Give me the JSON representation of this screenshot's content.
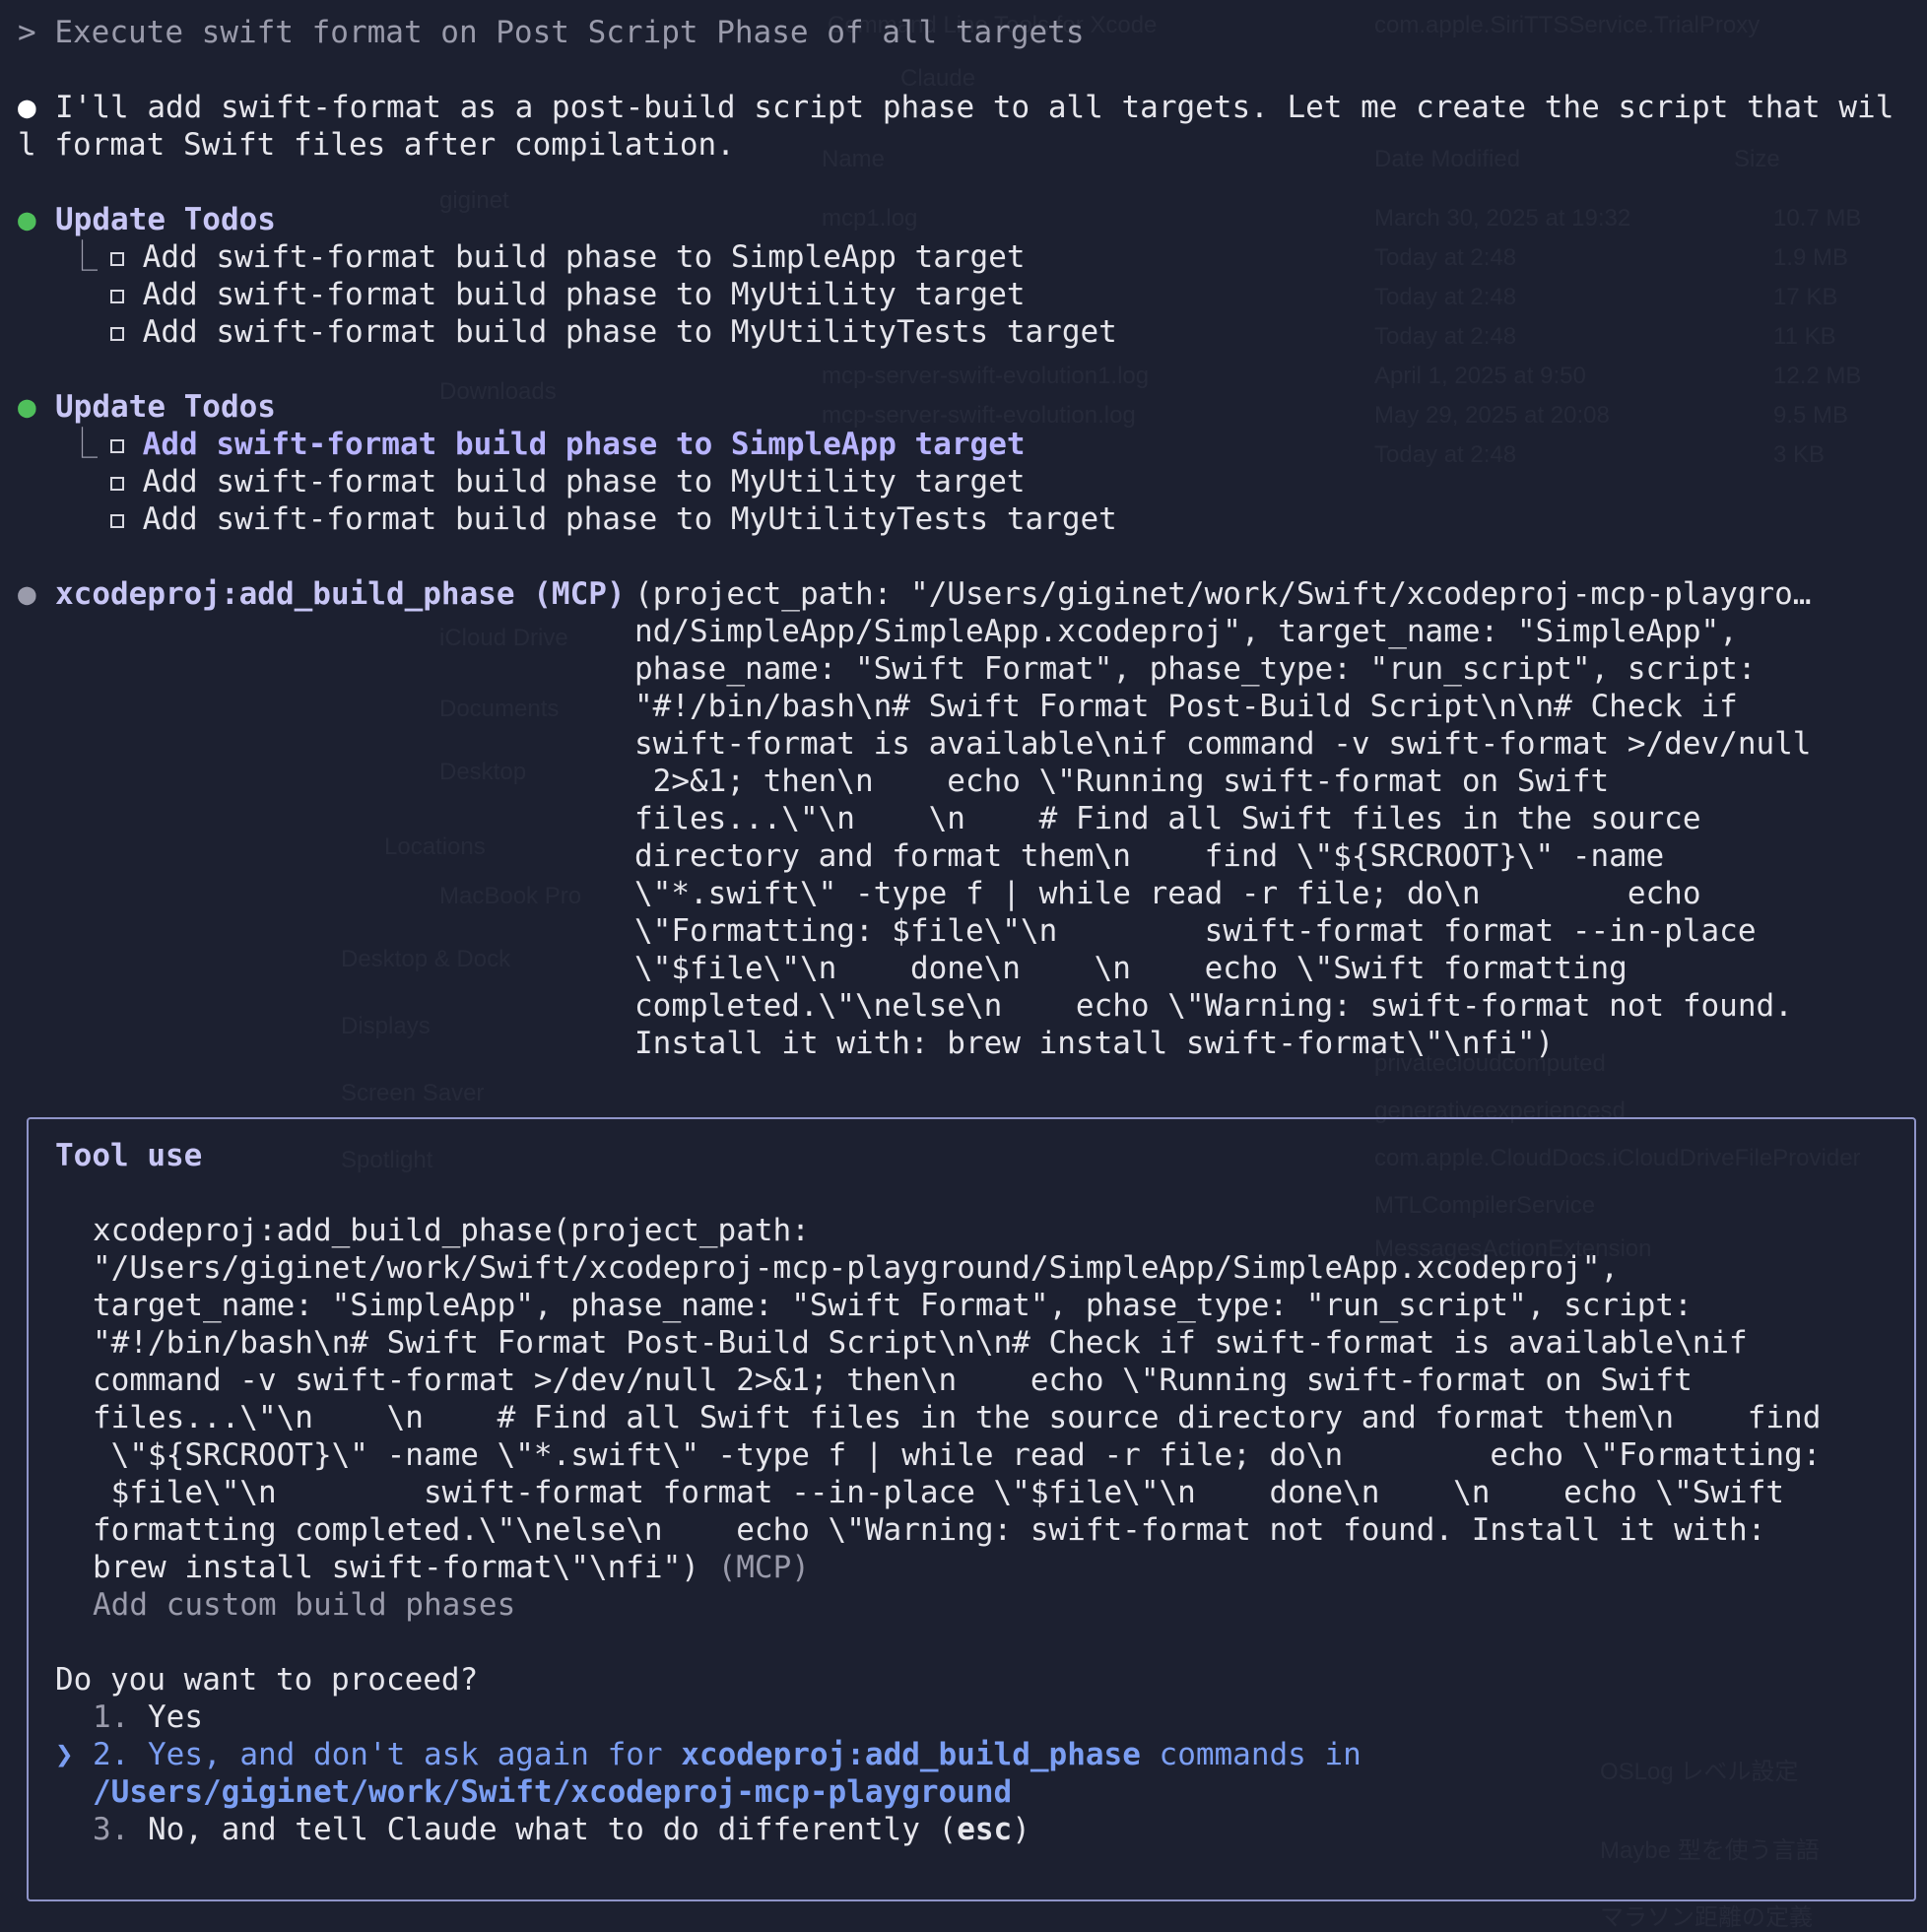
{
  "prompt": {
    "marker": ">",
    "text": "Execute swift format on Post Script Phase of all targets"
  },
  "assistant_message": {
    "line1": "I'll add swift-format as a post-build script phase to all targets. Let me create the script that wil",
    "line2": "l format Swift files after compilation."
  },
  "todo_blocks": [
    {
      "title": "Update Todos",
      "items": [
        "Add swift-format build phase to SimpleApp target",
        "Add swift-format build phase to MyUtility target",
        "Add swift-format build phase to MyUtilityTests target"
      ]
    },
    {
      "title": "Update Todos",
      "items": [
        "Add swift-format build phase to SimpleApp target",
        "Add swift-format build phase to MyUtility target",
        "Add swift-format build phase to MyUtilityTests target"
      ]
    }
  ],
  "tool_call": {
    "name": "xcodeproj:add_build_phase (MCP)",
    "lines": [
      "(project_path: \"/Users/giginet/work/Swift/xcodeproj-mcp-playgro…",
      "nd/SimpleApp/SimpleApp.xcodeproj\", target_name: \"SimpleApp\",",
      "phase_name: \"Swift Format\", phase_type: \"run_script\", script:",
      "\"#!/bin/bash\\n# Swift Format Post-Build Script\\n\\n# Check if",
      "swift-format is available\\nif command -v swift-format >/dev/null",
      " 2>&1; then\\n    echo \\\"Running swift-format on Swift",
      "files...\\\"\\n    \\n    # Find all Swift files in the source",
      "directory and format them\\n    find \\\"${SRCROOT}\\\" -name",
      "\\\"*.swift\\\" -type f | while read -r file; do\\n        echo",
      "\\\"Formatting: $file\\\"\\n        swift-format format --in-place",
      "\\\"$file\\\"\\n    done\\n    \\n    echo \\\"Swift formatting",
      "completed.\\\"\\nelse\\n    echo \\\"Warning: swift-format not found.",
      "Install it with: brew install swift-format\\\"\\nfi\")"
    ]
  },
  "tool_use_dialog": {
    "title": "Tool use",
    "call_lines": [
      "xcodeproj:add_build_phase(project_path:",
      "\"/Users/giginet/work/Swift/xcodeproj-mcp-playground/SimpleApp/SimpleApp.xcodeproj\",",
      "target_name: \"SimpleApp\", phase_name: \"Swift Format\", phase_type: \"run_script\", script:",
      "\"#!/bin/bash\\n# Swift Format Post-Build Script\\n\\n# Check if swift-format is available\\nif",
      "command -v swift-format >/dev/null 2>&1; then\\n    echo \\\"Running swift-format on Swift",
      "files...\\\"\\n    \\n    # Find all Swift files in the source directory and format them\\n    find",
      " \\\"${SRCROOT}\\\" -name \\\"*.swift\\\" -type f | while read -r file; do\\n        echo \\\"Formatting:",
      " $file\\\"\\n        swift-format format --in-place \\\"$file\\\"\\n    done\\n    \\n    echo \\\"Swift",
      "formatting completed.\\\"\\nelse\\n    echo \\\"Warning: swift-format not found. Install it with:",
      "brew install swift-format\\\"\\nfi\")"
    ],
    "call_suffix": "(MCP)",
    "description": "Add custom build phases",
    "question": "Do you want to proceed?",
    "options": {
      "opt1": {
        "number": "1.",
        "text": "Yes"
      },
      "opt2": {
        "cursor": "❯",
        "number": "2.",
        "pre": "Yes, and don't ask again for",
        "tool": "xcodeproj:add_build_phase",
        "mid": "commands in",
        "path": "/Users/giginet/work/Swift/xcodeproj-mcp-playground"
      },
      "opt3": {
        "number": "3.",
        "pre": "No, and tell Claude what to do differently (",
        "key": "esc",
        "post": ")"
      }
    }
  },
  "background_ghost": [
    "Command Line Tools for Xcode",
    "com.apple.SiriTTSService.TrialProxy",
    "Claude",
    "Name",
    "Date Modified",
    "Size",
    "mcp1.log",
    "March 30, 2025 at 19:32",
    "10.7 MB",
    "Today at 2:48",
    "1.9 MB",
    "Today at 2:48",
    "17 KB",
    "Today at 2:48",
    "11 KB",
    "mcp-server-swift-evolution1.log",
    "April 1, 2025 at 9:50",
    "12.2 MB",
    "mcp-server-swift-evolution.log",
    "May 29, 2025 at 20:08",
    "9.5 MB",
    "Today at 2:48",
    "3 KB",
    "giginet",
    "Downloads",
    "iCloud Drive",
    "Documents",
    "Desktop",
    "Locations",
    "MacBook Pro",
    "Desktop & Dock",
    "Displays",
    "Screen Saver",
    "Spotlight",
    "privatecloudcomputed",
    "generativeexperiencesd",
    "com.apple.CloudDocs.iCloudDriveFileProvider",
    "MTLCompilerService",
    "MessagesActionExtension",
    "OSLog レベル設定",
    "Maybe 型を使う言語",
    "マラソン距離の定義"
  ]
}
